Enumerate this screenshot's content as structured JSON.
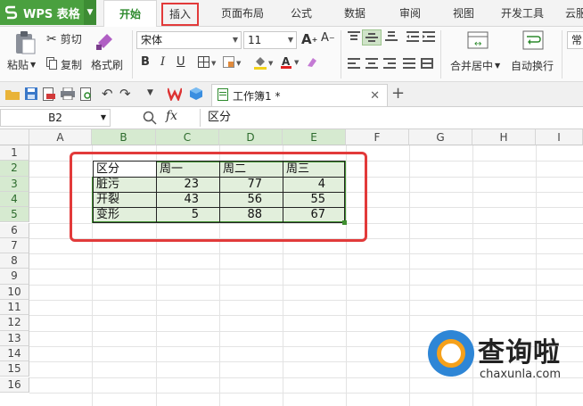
{
  "app": {
    "name": "WPS 表格"
  },
  "menu": {
    "tabs": [
      {
        "label": "开始"
      },
      {
        "label": "插入"
      },
      {
        "label": "页面布局"
      },
      {
        "label": "公式"
      },
      {
        "label": "数据"
      },
      {
        "label": "审阅"
      },
      {
        "label": "视图"
      },
      {
        "label": "开发工具"
      },
      {
        "label": "云服"
      }
    ]
  },
  "ribbon": {
    "paste": "粘贴",
    "cut": "剪切",
    "copy": "复制",
    "format_painter": "格式刷",
    "font": "宋体",
    "font_size": "11",
    "bold": "B",
    "italic": "I",
    "underline": "U",
    "merge_center": "合并居中",
    "wrap_text": "自动换行",
    "general": "常"
  },
  "doc": {
    "tab_title": "工作簿1 *"
  },
  "formula_bar": {
    "cell_ref": "B2",
    "fx": "fx",
    "value": "区分"
  },
  "sheet": {
    "columns": [
      "A",
      "B",
      "C",
      "D",
      "E",
      "F",
      "G",
      "H",
      "I"
    ],
    "rows": [
      "1",
      "2",
      "3",
      "4",
      "5",
      "6",
      "7",
      "8",
      "9",
      "10",
      "11",
      "12",
      "13",
      "14",
      "15",
      "16"
    ],
    "table": {
      "header": [
        "区分",
        "周一",
        "周二",
        "周三"
      ],
      "rows": [
        [
          "脏污",
          "23",
          "77",
          "4"
        ],
        [
          "开裂",
          "43",
          "56",
          "55"
        ],
        [
          "变形",
          "5",
          "88",
          "67"
        ]
      ]
    }
  },
  "watermark": {
    "title": "查询啦",
    "url": "chaxunla.com"
  },
  "colors": {
    "accent": "#4aa03f",
    "highlight": "#e23a3a",
    "selection": "#e2efdc"
  }
}
